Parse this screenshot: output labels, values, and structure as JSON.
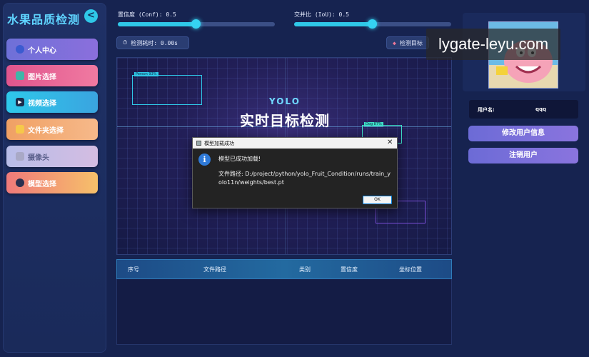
{
  "sidebar": {
    "title": "水果品质检测",
    "collapse_icon": "<",
    "items": [
      {
        "label": "个人中心",
        "icon": "user-icon"
      },
      {
        "label": "图片选择",
        "icon": "image-icon"
      },
      {
        "label": "视频选择",
        "icon": "video-icon"
      },
      {
        "label": "文件夹选择",
        "icon": "folder-icon"
      },
      {
        "label": "摄像头",
        "icon": "camera-icon"
      },
      {
        "label": "模型选择",
        "icon": "model-icon"
      }
    ]
  },
  "controls": {
    "conf_label": "置信度 (Conf): 0.5",
    "conf_value": 0.5,
    "iou_label": "交并比 (IoU): 0.5",
    "iou_value": 0.5,
    "time_label": "检测耗时: 0.00s",
    "target_label": "检测目标"
  },
  "display": {
    "subtitle": "YOLO",
    "headline": "实时目标检测",
    "box1_tag": "Person 93%",
    "box2_tag": "Dog 87%"
  },
  "table": {
    "columns": [
      "序号",
      "文件路径",
      "类别",
      "置信度",
      "坐标位置"
    ]
  },
  "user": {
    "name_label": "用户名:",
    "name_value": "qqq",
    "edit_button": "修改用户信息",
    "logout_button": "注销用户"
  },
  "watermark": "lygate-leyu.com",
  "dialog": {
    "title": "模型加载成功",
    "close": "✕",
    "message": "模型已成功加载!",
    "path": "文件路径: D:/project/python/yolo_Fruit_Condition/runs/train_yolo11n/weights/best.pt",
    "ok": "OK"
  },
  "colors": {
    "accent": "#2fc8e8",
    "background": "#162350"
  }
}
